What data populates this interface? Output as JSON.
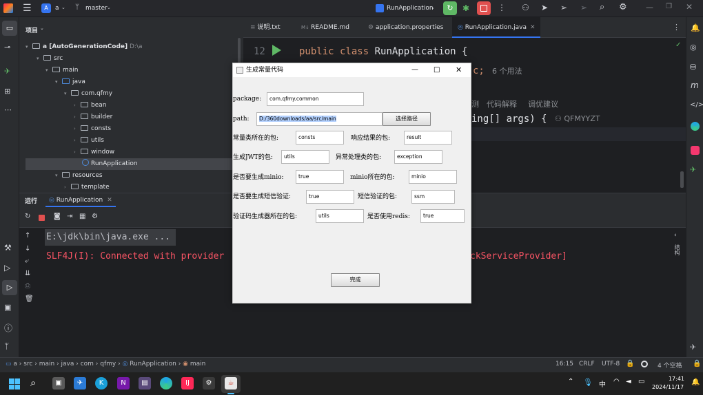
{
  "titlebar": {
    "project_letter": "A",
    "project_name": "a",
    "branch": "master",
    "run_config": "RunApplication"
  },
  "project_panel": {
    "title": "项目",
    "tree": [
      {
        "label": "a [AutoGenerationCode]",
        "suffix": "D:\\a"
      },
      {
        "label": "src"
      },
      {
        "label": "main"
      },
      {
        "label": "java"
      },
      {
        "label": "com.qfmy"
      },
      {
        "label": "bean"
      },
      {
        "label": "builder"
      },
      {
        "label": "consts"
      },
      {
        "label": "utils"
      },
      {
        "label": "window"
      },
      {
        "label": "RunApplication"
      },
      {
        "label": "resources"
      },
      {
        "label": "template"
      }
    ]
  },
  "editor": {
    "tabs": [
      {
        "label": "说明.txt"
      },
      {
        "label": "README.md"
      },
      {
        "label": "application.properties"
      },
      {
        "label": "RunApplication.java"
      }
    ],
    "line_number": "12",
    "code_kw": "public class",
    "code_name": "RunApplication {",
    "hint_c": "c;",
    "usages": "6 个用法",
    "inlay_1": "测",
    "inlay_2": "代码解释",
    "inlay_3": "调优建议",
    "code_frag": "ing[] args) {",
    "author": "QFMYYZT"
  },
  "run_panel": {
    "label": "运行",
    "tab": "RunApplication",
    "console_line1": "E:\\jdk\\bin\\java.exe ...",
    "console_line2a": "SLF4J(I): Connected with provider",
    "console_line2b": "ckServiceProvider]",
    "side_label": "结构"
  },
  "dialog": {
    "title": "生成常量代码",
    "package_label": "package:",
    "package_value": "com.qfmy.common",
    "path_label": "path:",
    "path_value": "D:/360downloads/aa/src/main",
    "path_value_visible": "D:/360downloads/aa/src/main",
    "choose_path_button": "选择路径",
    "consts_label": "常量类所在的包:",
    "consts_value": "consts",
    "result_label": "响应结果的包:",
    "result_value": "result",
    "jwt_label": "生成JWT的包:",
    "jwt_value": "utils",
    "exception_label": "异常处理类的包:",
    "exception_value": "exception",
    "minio_gen_label": "是否要生成minio:",
    "minio_gen_value": "true",
    "minio_pkg_label": "minio所在的包:",
    "minio_pkg_value": "minio",
    "sms_gen_label": "是否要生成短信验证:",
    "sms_gen_value": "true",
    "sms_pkg_label": "短信验证的包:",
    "sms_pkg_value": "ssm",
    "captcha_label": "验证码生成器所在的包:",
    "captcha_value": "utils",
    "redis_label": "是否使用redis:",
    "redis_value": "true",
    "done_button": "完成"
  },
  "statusbar": {
    "breadcrumbs": [
      "a",
      "src",
      "main",
      "java",
      "com",
      "qfmy",
      "RunApplication",
      "main"
    ],
    "position": "16:15",
    "line_sep": "CRLF",
    "encoding": "UTF-8",
    "indent": "4 个空格"
  },
  "taskbar": {
    "ime": "中",
    "time": "17:41",
    "date": "2024/11/17"
  },
  "colors": {
    "accent": "#3574f0",
    "run_green": "#5fb865",
    "error_red": "#f75464"
  }
}
